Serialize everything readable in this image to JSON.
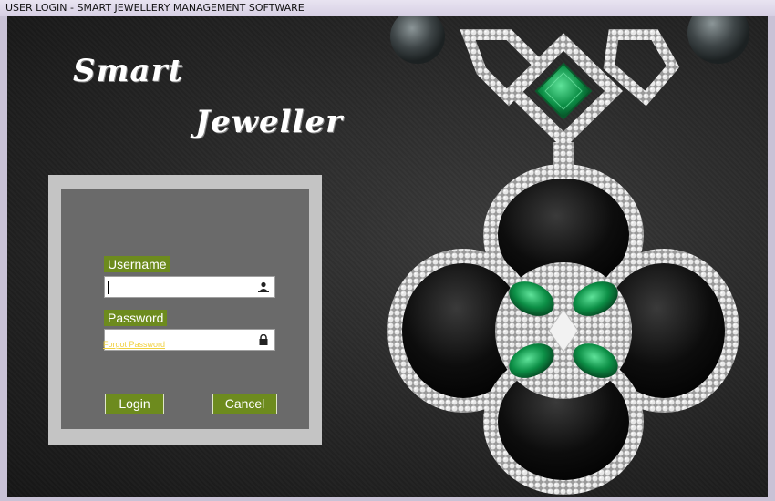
{
  "window": {
    "title": "USER LOGIN -  SMART JEWELLERY MANAGEMENT SOFTWARE"
  },
  "brand": {
    "line1": "Smart",
    "line2": "Jeweller"
  },
  "login": {
    "username_label": "Username",
    "username_value": "",
    "password_label": "Password",
    "password_value": "",
    "forgot_label": "Forgot Password",
    "login_label": "Login",
    "cancel_label": "Cancel"
  },
  "icons": {
    "username": "user-icon",
    "password": "lock-icon"
  },
  "colors": {
    "accent_green": "#6d8b1e",
    "forgot_link": "#f0d140",
    "panel_gray": "#6a6a6a",
    "panel_border": "#c4c4c4"
  }
}
